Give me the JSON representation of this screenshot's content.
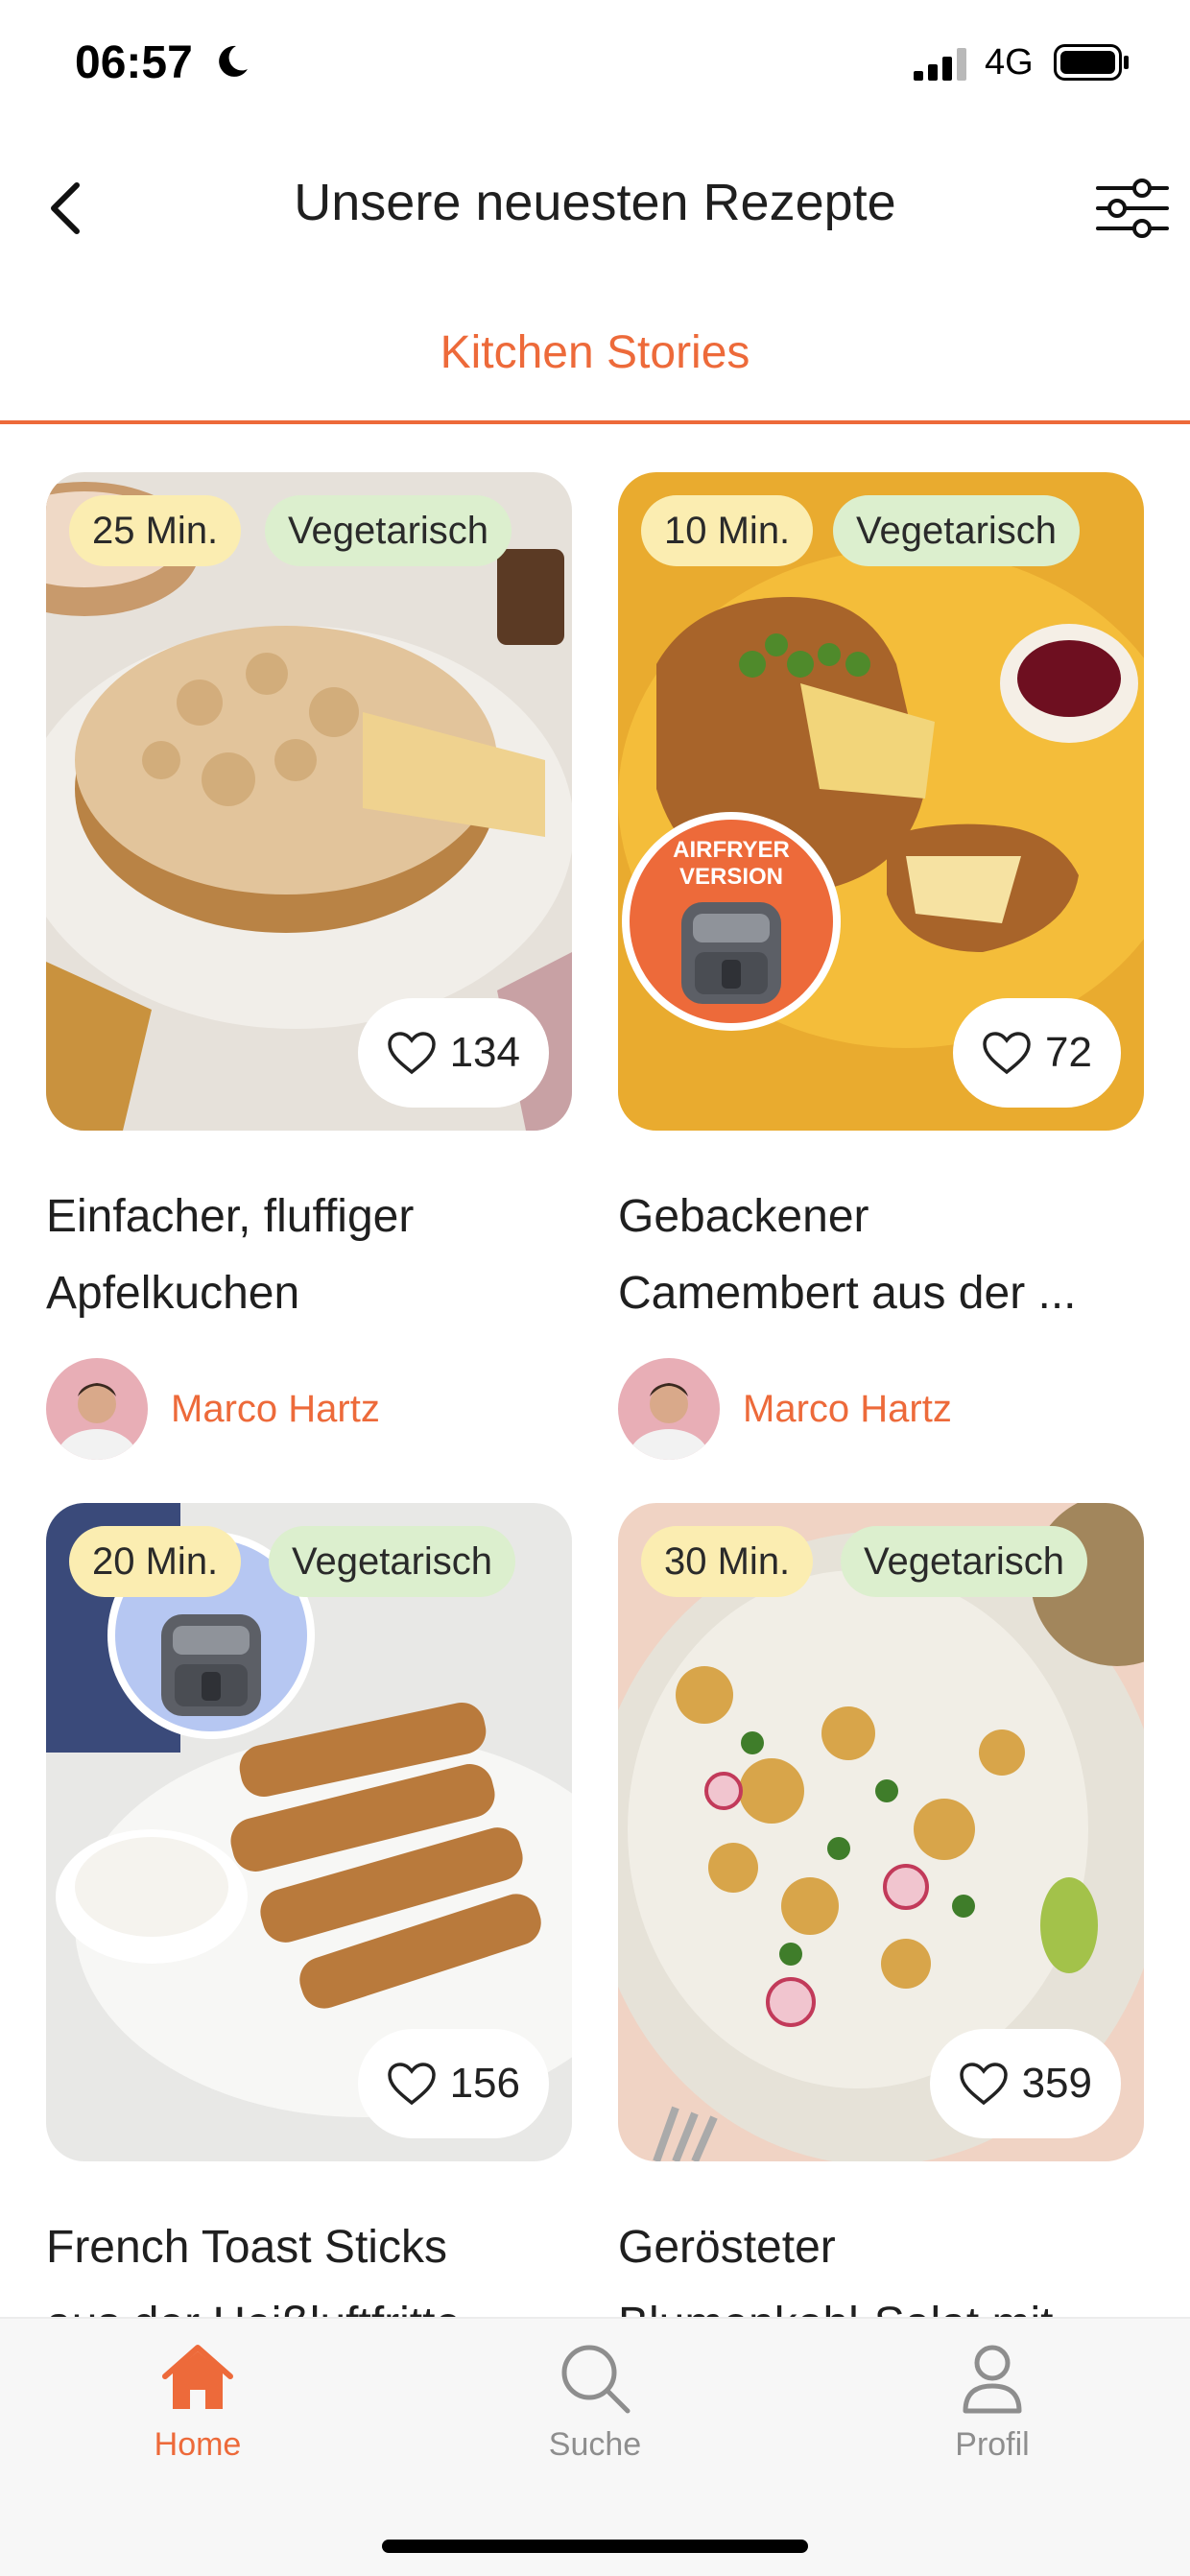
{
  "status_bar": {
    "time": "06:57",
    "network": "4G"
  },
  "header": {
    "title": "Unsere neuesten Rezepte"
  },
  "tabs": [
    {
      "label": "Kitchen Stories",
      "active": true
    }
  ],
  "recipes": [
    {
      "time": "25 Min.",
      "tag": "Vegetarisch",
      "likes": "134",
      "title_line1": "Einfacher, fluffiger",
      "title_line2": "Apfelkuchen",
      "author": "Marco Hartz",
      "airfryer": false
    },
    {
      "time": "10 Min.",
      "tag": "Vegetarisch",
      "likes": "72",
      "title_line1": "Gebackener",
      "title_line2": "Camembert aus der ...",
      "author": "Marco Hartz",
      "airfryer": true
    },
    {
      "time": "20 Min.",
      "tag": "Vegetarisch",
      "likes": "156",
      "title_line1": "French Toast Sticks",
      "title_line2": "aus der Heißluftfritte...",
      "airfryer": true
    },
    {
      "time": "30 Min.",
      "tag": "Vegetarisch",
      "likes": "359",
      "title_line1": "Gerösteter",
      "title_line2": "Blumenkohl-Salat mit ..."
    }
  ],
  "badge_text": {
    "line1": "AIRFRYER",
    "line2": "VERSION"
  },
  "bottom_nav": [
    {
      "label": "Home",
      "active": true
    },
    {
      "label": "Suche",
      "active": false
    },
    {
      "label": "Profil",
      "active": false
    }
  ],
  "colors": {
    "accent": "#ed6a3a",
    "time_pill": "#fbedb1",
    "tag_pill": "#dcefce",
    "inactive_nav": "#8e8e8e"
  }
}
